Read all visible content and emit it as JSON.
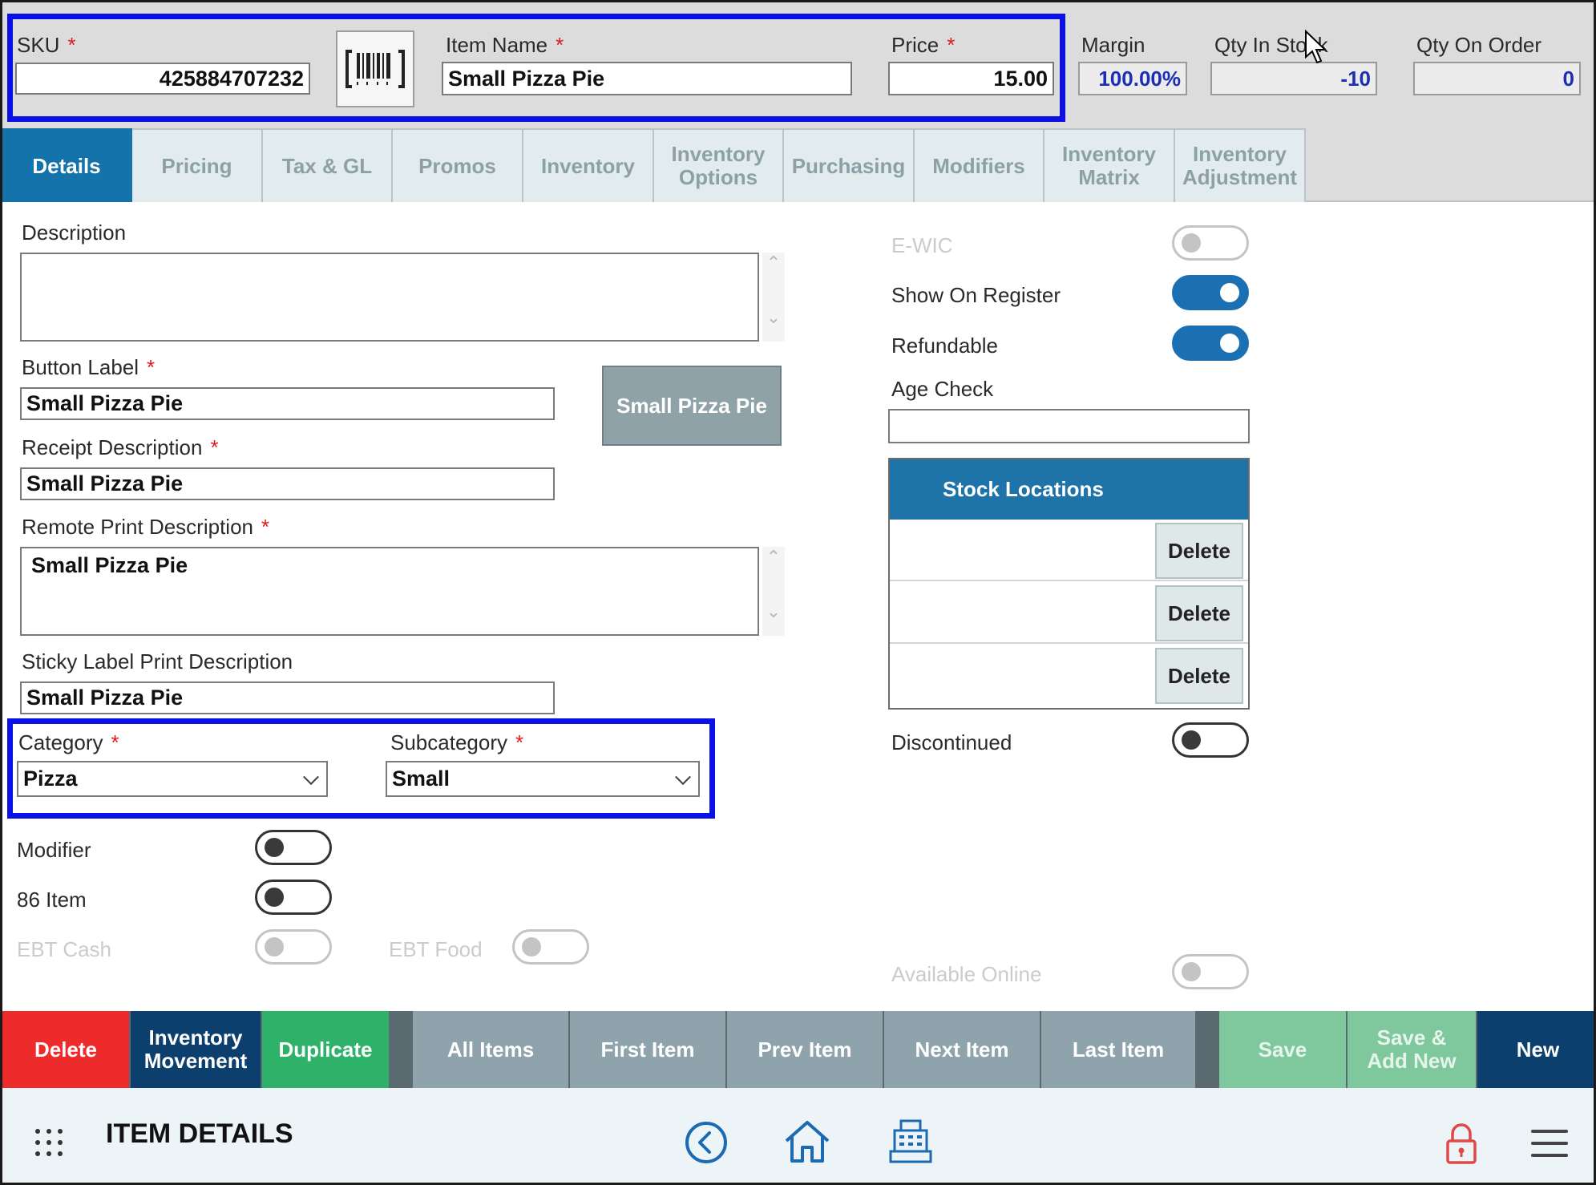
{
  "header": {
    "sku_label": "SKU",
    "sku_value": "425884707232",
    "item_name_label": "Item Name",
    "item_name_value": "Small Pizza Pie",
    "price_label": "Price",
    "price_value": "15.00",
    "margin_label": "Margin",
    "margin_value": "100.00%",
    "qty_in_stock_label": "Qty In Stock",
    "qty_in_stock_value": "-10",
    "qty_on_order_label": "Qty On Order",
    "qty_on_order_value": "0",
    "required_mark": "*"
  },
  "tabs": [
    {
      "label": "Details",
      "active": true
    },
    {
      "label": "Pricing"
    },
    {
      "label": "Tax & GL"
    },
    {
      "label": "Promos"
    },
    {
      "label": "Inventory"
    },
    {
      "label": "Inventory Options"
    },
    {
      "label": "Purchasing"
    },
    {
      "label": "Modifiers"
    },
    {
      "label": "Inventory Matrix"
    },
    {
      "label": "Inventory Adjustment"
    }
  ],
  "form": {
    "description_label": "Description",
    "description_value": "",
    "button_label_label": "Button Label",
    "button_label_value": "Small Pizza Pie",
    "button_preview": "Small Pizza Pie",
    "receipt_label": "Receipt Description",
    "receipt_value": "Small Pizza Pie",
    "remote_print_label": "Remote Print Description",
    "remote_print_value": "Small Pizza Pie",
    "sticky_label": "Sticky Label Print Description",
    "sticky_value": "Small Pizza Pie",
    "category_label": "Category",
    "category_value": "Pizza",
    "subcategory_label": "Subcategory",
    "subcategory_value": "Small",
    "modifier_label": "Modifier",
    "item86_label": "86 Item",
    "ebt_cash_label": "EBT Cash",
    "ebt_food_label": "EBT Food"
  },
  "right": {
    "ewic_label": "E-WIC",
    "show_on_register_label": "Show On Register",
    "refundable_label": "Refundable",
    "age_check_label": "Age Check",
    "age_check_value": "",
    "stock_locations_title": "Stock Locations",
    "delete_label": "Delete",
    "discontinued_label": "Discontinued",
    "available_online_label": "Available Online"
  },
  "toggles": {
    "ewic": false,
    "show_on_register": true,
    "refundable": true,
    "discontinued": false,
    "modifier": false,
    "item86": false,
    "ebt_cash": false,
    "ebt_food": false,
    "available_online": false
  },
  "actions": {
    "delete": "Delete",
    "inventory_movement": "Inventory Movement",
    "duplicate": "Duplicate",
    "all_items": "All Items",
    "first_item": "First Item",
    "prev_item": "Prev Item",
    "next_item": "Next Item",
    "last_item": "Last Item",
    "save": "Save",
    "save_add_new": "Save & Add New",
    "new": "New"
  },
  "footer": {
    "title": "ITEM DETAILS"
  },
  "colors": {
    "active_tab": "#1573ac",
    "delete_red": "#ee2b2b",
    "navy": "#0c3f6e",
    "green": "#2eb26a",
    "nav_gray": "#8fa3ac",
    "highlight_blue": "#0b10e6",
    "lock_red": "#e04848"
  }
}
